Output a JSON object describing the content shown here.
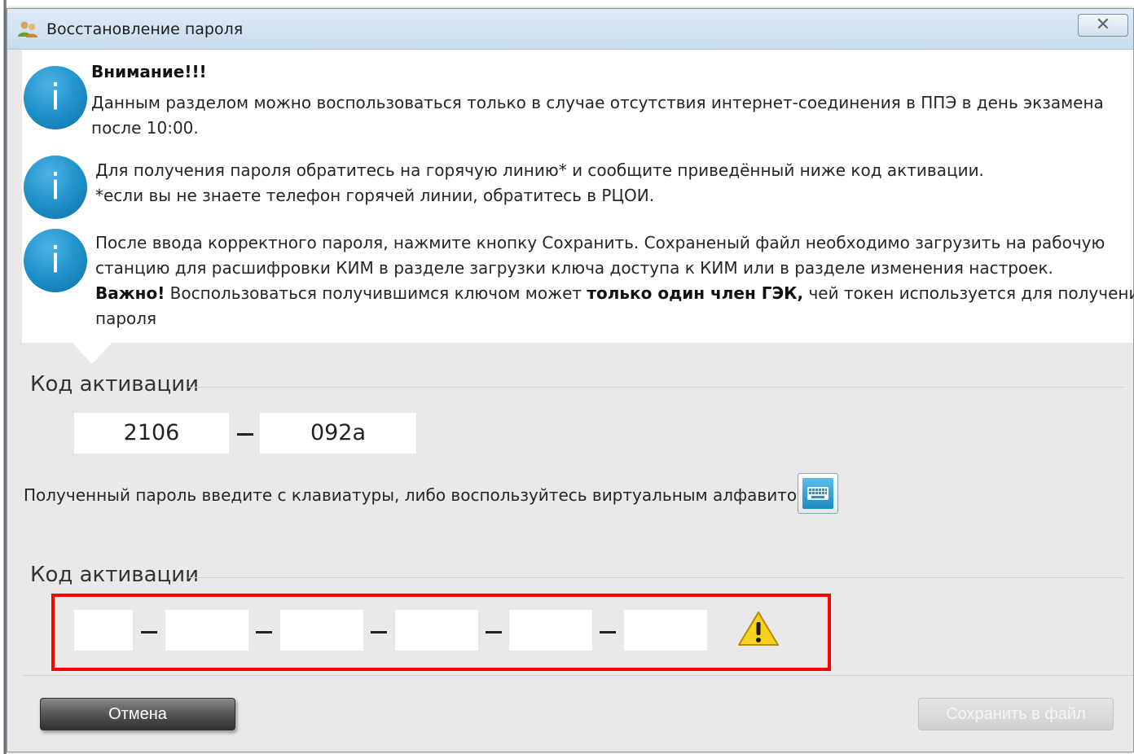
{
  "window": {
    "title": "Восстановление пароля",
    "close_glyph": "✕"
  },
  "info": {
    "warning_heading": "Внимание!!!",
    "warning_line1": "Данным разделом можно воспользоваться только в случае отсутствия интернет-соединения в ППЭ в день экзамена",
    "warning_line2": "после 10:00.",
    "hotline_line1": "Для получения пароля обратитесь на горячую линию* и сообщите приведённый ниже код активации.",
    "hotline_line2": "*если вы не знаете телефон горячей линии, обратитесь в РЦОИ.",
    "save_line1": "После ввода корректного пароля, нажмите кнопку Сохранить. Сохраненый файл необходимо загрузить на рабочую",
    "save_line2": "станцию для расшифровки КИМ в разделе загрузки ключа доступа к КИМ или в разделе изменения настроек.",
    "important_label": "Важно!",
    "important_text1": " Воспользоваться получившимся ключом может ",
    "important_bold": "только один член ГЭК,",
    "important_text2": " чей токен используется для получения",
    "important_line2": "пароля",
    "icon_glyph": "i"
  },
  "activation": {
    "label": "Код активации",
    "code_part1": "2106",
    "code_part2": "092a"
  },
  "password": {
    "hint": "Полученный пароль введите с клавиатуры, либо воспользуйтесь виртуальным алфавитом.",
    "label": "Код активации",
    "fields": [
      "",
      "",
      "",
      "",
      "",
      ""
    ],
    "warning_icon": "warning-icon"
  },
  "buttons": {
    "cancel": "Отмена",
    "save": "Сохранить в файл"
  },
  "colors": {
    "info_blue": "#1d8ec7",
    "highlight_red": "#ff0000",
    "warning_yellow": "#f7d21e"
  }
}
